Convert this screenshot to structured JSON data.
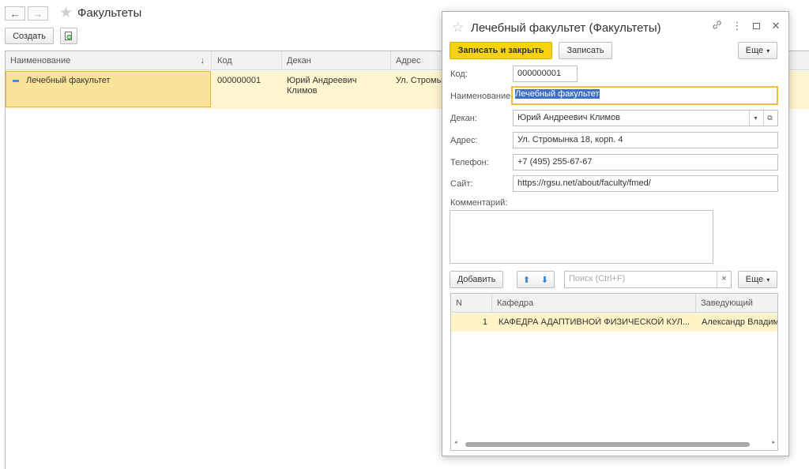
{
  "main": {
    "title": "Факультеты",
    "back_icon": "←",
    "forward_icon": "→",
    "create_button": "Создать",
    "columns": [
      "Наименование",
      "Код",
      "Декан",
      "Адрес"
    ],
    "sort_icon": "↓",
    "rows": [
      {
        "name": "Лечебный факультет",
        "code": "000000001",
        "dean_line1": "Юрий Андреевич",
        "dean_line2": "Климов",
        "address": "Ул. Стромынка"
      }
    ]
  },
  "dialog": {
    "title": "Лечебный факультет (Факультеты)",
    "save_close_button": "Записать и закрыть",
    "save_button": "Записать",
    "more_button": "Еще",
    "fields": {
      "code_label": "Код:",
      "code_value": "000000001",
      "name_label": "Наименование:",
      "name_value": "Лечебный факультет",
      "dean_label": "Декан:",
      "dean_value": "Юрий Андреевич Климов",
      "address_label": "Адрес:",
      "address_value": "Ул. Стромынка 18, корп. 4",
      "phone_label": "Телефон:",
      "phone_value": "+7 (495) 255-67-67",
      "site_label": "Сайт:",
      "site_value": "https://rgsu.net/about/faculty/fmed/",
      "comment_label": "Комментарий:",
      "comment_value": ""
    },
    "table_toolbar": {
      "add_button": "Добавить",
      "search_placeholder": "Поиск (Ctrl+F)",
      "clear_icon": "×",
      "more_button": "Еще"
    },
    "table": {
      "columns": [
        "N",
        "Кафедра",
        "Заведующий"
      ],
      "rows": [
        {
          "n": "1",
          "department": "КАФЕДРА АДАПТИВНОЙ ФИЗИЧЕСКОЙ КУЛ...",
          "head": "Александр Владим"
        }
      ]
    }
  },
  "colors": {
    "accent_yellow": "#f5d40f",
    "selected_row": "#fff5cf",
    "focus_border": "#e9c03c",
    "arrow_blue": "#3a86d6"
  }
}
